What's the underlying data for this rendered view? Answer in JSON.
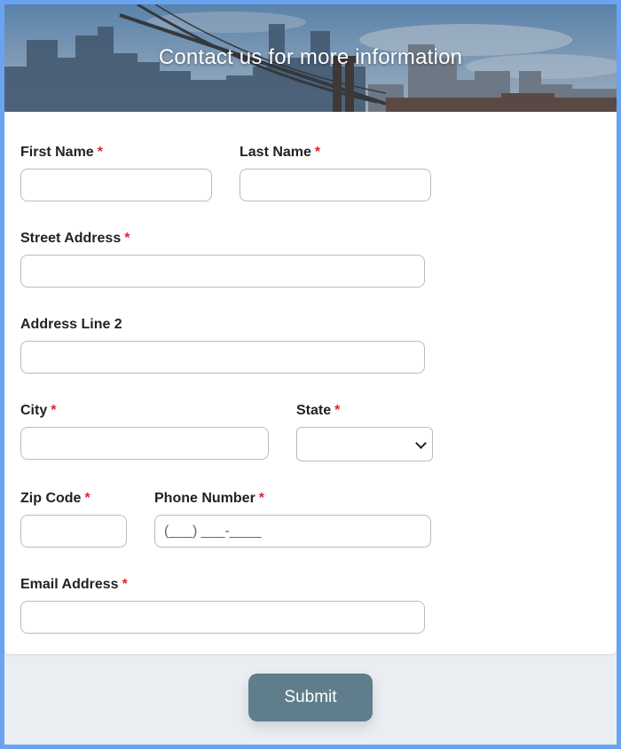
{
  "header": {
    "title": "Contact us for more information"
  },
  "form": {
    "required_mark": "*",
    "first_name": {
      "label": "First Name",
      "value": "",
      "placeholder": ""
    },
    "last_name": {
      "label": "Last Name",
      "value": "",
      "placeholder": ""
    },
    "street_address": {
      "label": "Street Address",
      "value": "",
      "placeholder": ""
    },
    "address_line_2": {
      "label": "Address Line 2",
      "value": "",
      "placeholder": ""
    },
    "city": {
      "label": "City",
      "value": "",
      "placeholder": ""
    },
    "state": {
      "label": "State",
      "selected": ""
    },
    "zip_code": {
      "label": "Zip Code",
      "value": "",
      "placeholder": ""
    },
    "phone_number": {
      "label": "Phone Number",
      "value": "",
      "placeholder": "(___) ___-____"
    },
    "email_address": {
      "label": "Email Address",
      "value": "",
      "placeholder": ""
    }
  },
  "submit": {
    "label": "Submit"
  },
  "colors": {
    "frame_border": "#6aa4f0",
    "required": "#e0242c",
    "submit_bg": "#607d8b",
    "page_bg": "#eaedf1"
  },
  "icons": {
    "state_select": "chevron-down-icon"
  }
}
